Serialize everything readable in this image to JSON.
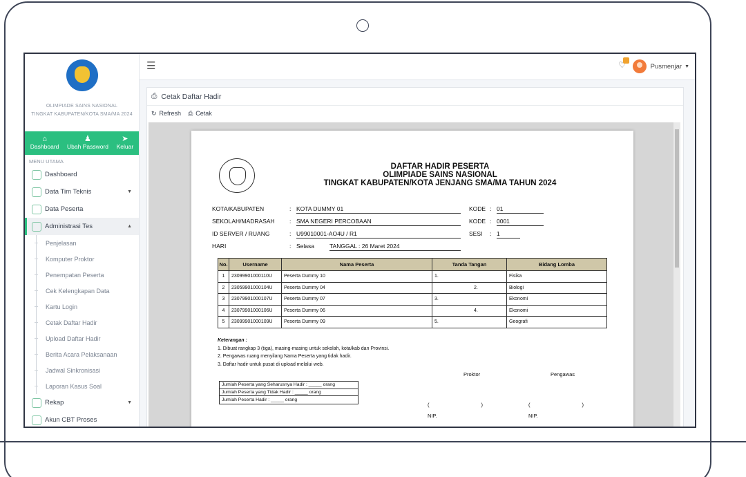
{
  "sidebar": {
    "brand_line1": "OLIMPIADE SAINS NASIONAL",
    "brand_line2": "TINGKAT KABUPATEN/KOTA SMA/MA 2024",
    "quick": [
      "Dashboard",
      "Ubah Password",
      "Keluar"
    ],
    "menu_head": "MENU UTAMA",
    "items": [
      {
        "label": "Dashboard"
      },
      {
        "label": "Data Tim Teknis"
      },
      {
        "label": "Data Peserta"
      },
      {
        "label": "Administrasi Tes"
      }
    ],
    "sub_items": [
      "Penjelasan",
      "Komputer Proktor",
      "Penempatan Peserta",
      "Cek Kelengkapan Data",
      "Kartu Login",
      "Cetak Daftar Hadir",
      "Upload Daftar Hadir",
      "Berita Acara Pelaksanaan",
      "Jadwal Sinkronisasi",
      "Laporan Kasus Soal"
    ],
    "bottom_items": [
      "Rekap",
      "Akun CBT Proses"
    ]
  },
  "topbar": {
    "user": "Pusmenjar"
  },
  "panel": {
    "title": "Cetak Daftar Hadir",
    "refresh": "Refresh",
    "print": "Cetak"
  },
  "doc": {
    "title1": "DAFTAR HADIR PESERTA",
    "title2": "OLIMPIADE SAINS NASIONAL",
    "title3": "TINGKAT KABUPATEN/KOTA JENJANG SMA/MA TAHUN 2024",
    "kota_label": "KOTA/KABUPATEN",
    "kota": "KOTA DUMMY 01",
    "kode_label": "KODE",
    "kode1": "01",
    "sekolah_label": "SEKOLAH/MADRASAH",
    "sekolah": "SMA NEGERI PERCOBAAN",
    "kode2": "0001",
    "server_label": "ID SERVER / RUANG",
    "server": "U99010001-AO4U / R1",
    "sesi_label": "SESI",
    "sesi": "1",
    "hari_label": "HARI",
    "hari": "Selasa",
    "tanggal": "TANGGAL : 26 Maret 2024",
    "headers": [
      "No.",
      "Username",
      "Nama Peserta",
      "Tanda Tangan",
      "Bidang Lomba"
    ],
    "rows": [
      {
        "no": "1",
        "user": "23099901000110U",
        "nama": "Peserta Dummy 10",
        "ttd": "1.",
        "bidang": "Fisika"
      },
      {
        "no": "2",
        "user": "23059901000104U",
        "nama": "Peserta Dummy 04",
        "ttd": "2.",
        "bidang": "Biologi"
      },
      {
        "no": "3",
        "user": "23079901000107U",
        "nama": "Peserta Dummy 07",
        "ttd": "3.",
        "bidang": "Ekonomi"
      },
      {
        "no": "4",
        "user": "23079901000106U",
        "nama": "Peserta Dummy 06",
        "ttd": "4.",
        "bidang": "Ekonomi"
      },
      {
        "no": "5",
        "user": "23099901000109U",
        "nama": "Peserta Dummy 09",
        "ttd": "5.",
        "bidang": "Geografi"
      }
    ],
    "notes_head": "Keterangan :",
    "note1": "1. Dibuat rangkap 3 (tiga), masing-masing untuk sekolah, kota/kab dan Provinsi.",
    "note2": "2. Pengawas ruang menyilang Nama Peserta yang tidak hadir.",
    "note3": "3. Daftar hadir untuk pusat di upload melalui web.",
    "proktor": "Proktor",
    "pengawas": "Pengawas",
    "sum1": "Jumlah Peserta yang Seharusnya Hadir :  _____ orang",
    "sum2": "Jumlah Peserta yang Tidak Hadir        :  _____ orang",
    "sum3": "Jumlah Peserta Hadir                         :  _____ orang",
    "paren": "(                                    )",
    "nip": "NIP."
  }
}
